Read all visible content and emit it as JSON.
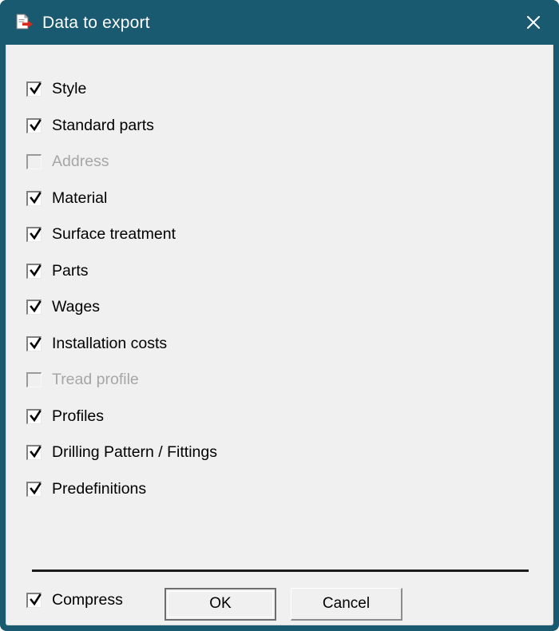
{
  "window": {
    "title": "Data to export",
    "title_icon": "export-document-icon",
    "close_icon": "close-icon",
    "titlebar_color": "#1a5a70",
    "client_color": "#f0f0f0",
    "accent_color": "#d92b1c"
  },
  "options": [
    {
      "label": "Style",
      "checked": true,
      "enabled": true
    },
    {
      "label": "Standard parts",
      "checked": true,
      "enabled": true
    },
    {
      "label": "Address",
      "checked": false,
      "enabled": false
    },
    {
      "label": "Material",
      "checked": true,
      "enabled": true
    },
    {
      "label": "Surface treatment",
      "checked": true,
      "enabled": true
    },
    {
      "label": "Parts",
      "checked": true,
      "enabled": true
    },
    {
      "label": "Wages",
      "checked": true,
      "enabled": true
    },
    {
      "label": "Installation costs",
      "checked": true,
      "enabled": true
    },
    {
      "label": "Tread profile",
      "checked": false,
      "enabled": false
    },
    {
      "label": "Profiles",
      "checked": true,
      "enabled": true
    },
    {
      "label": "Drilling Pattern / Fittings",
      "checked": true,
      "enabled": true
    },
    {
      "label": "Predefinitions",
      "checked": true,
      "enabled": true
    }
  ],
  "compress": {
    "label": "Compress",
    "checked": true,
    "enabled": true
  },
  "buttons": {
    "ok": "OK",
    "cancel": "Cancel"
  }
}
